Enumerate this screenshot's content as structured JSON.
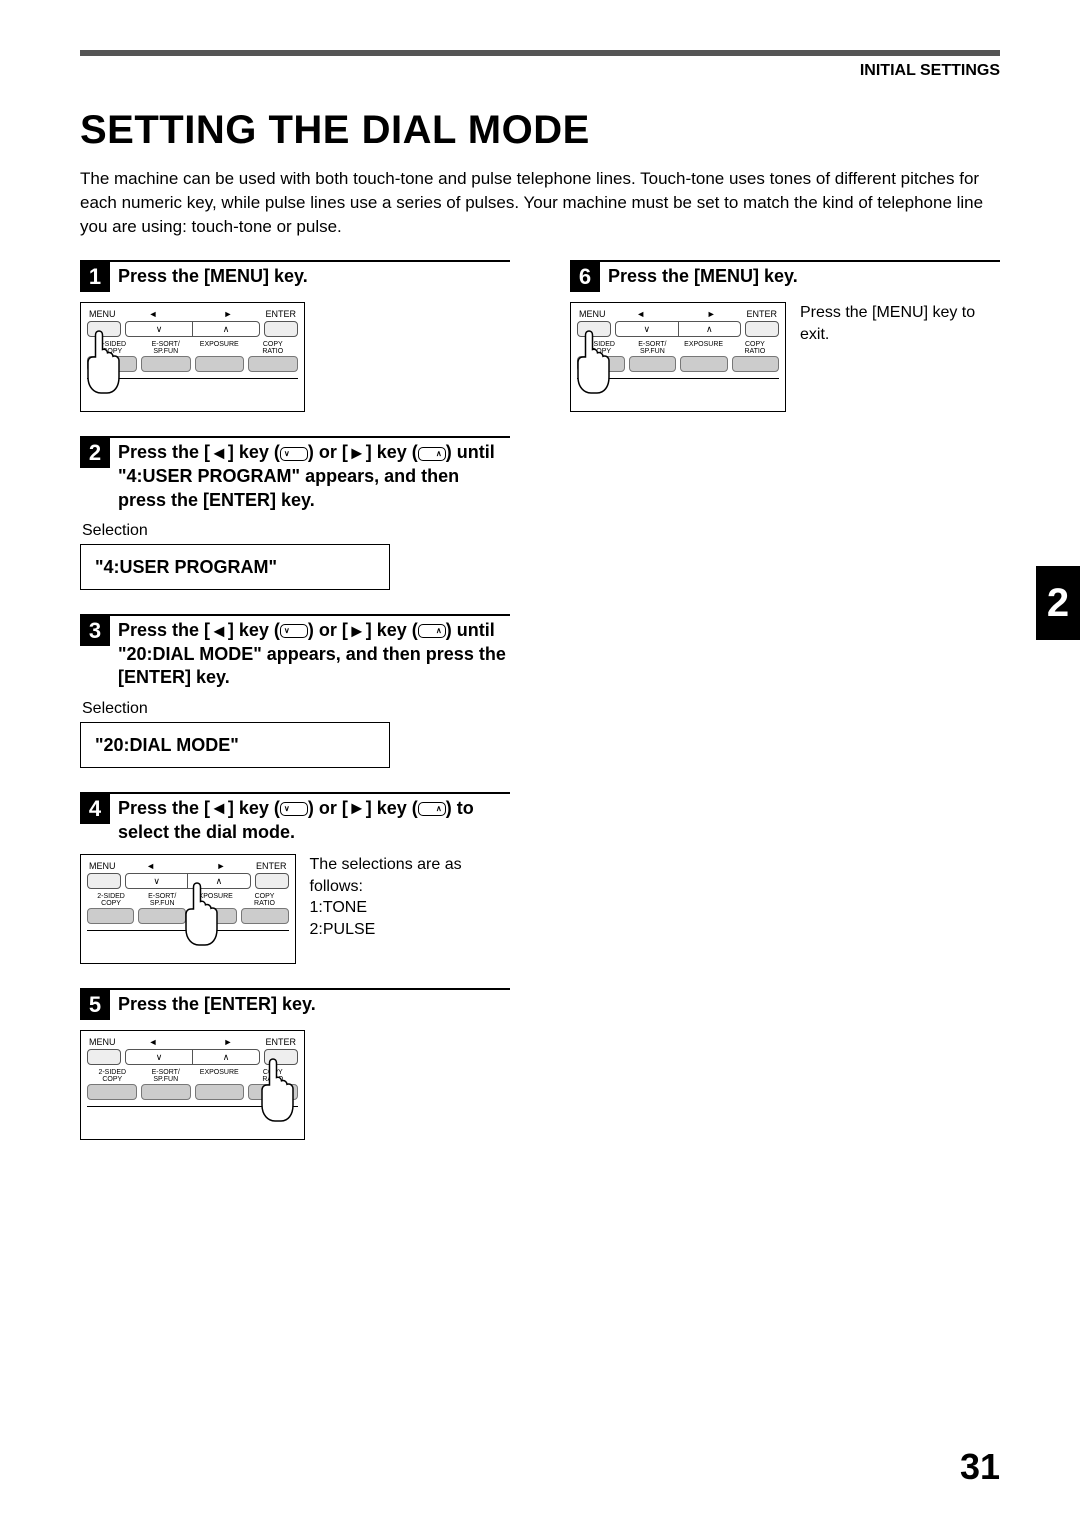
{
  "header": {
    "section": "INITIAL SETTINGS"
  },
  "title": "SETTING THE DIAL MODE",
  "intro": "The machine can be used with both touch-tone and pulse telephone lines. Touch-tone uses tones of different pitches for each numeric key, while pulse lines use a series of pulses. Your machine must be set to match the kind of telephone line you are using: touch-tone or pulse.",
  "panel": {
    "labels": {
      "menu": "MENU",
      "enter": "ENTER",
      "sided": "2-SIDED",
      "copy_under": "COPY",
      "esort": "E-SORT/",
      "spfun": "SP.FUN",
      "exposure": "EXPOSURE",
      "copyratio1": "COPY",
      "copyratio2": "RATIO",
      "left_tri": "◄",
      "right_tri": "►",
      "down": "∨",
      "up": "∧"
    }
  },
  "steps": {
    "s1": {
      "num": "1",
      "title": "Press the [MENU] key."
    },
    "s2": {
      "num": "2",
      "title_pre": "Press the [",
      "title_mid1": "] key (",
      "title_mid2": ") or [",
      "title_mid3": "] key (",
      "title_post": ") until \"4:USER PROGRAM\" appears, and then press the [ENTER] key.",
      "selection_label": "Selection",
      "display": "\"4:USER PROGRAM\""
    },
    "s3": {
      "num": "3",
      "title_pre": "Press the [",
      "title_mid1": "] key (",
      "title_mid2": ") or [",
      "title_mid3": "] key (",
      "title_post": ") until \"20:DIAL MODE\" appears, and then press the [ENTER] key.",
      "selection_label": "Selection",
      "display": "\"20:DIAL MODE\""
    },
    "s4": {
      "num": "4",
      "title_pre": "Press the [",
      "title_mid1": "] key (",
      "title_mid2": ") or [",
      "title_mid3": "] key (",
      "title_post": ") to select the dial mode.",
      "body": "The selections are as follows:\n1:TONE\n2:PULSE"
    },
    "s5": {
      "num": "5",
      "title": "Press the [ENTER] key."
    },
    "s6": {
      "num": "6",
      "title": "Press the [MENU] key.",
      "body": "Press the [MENU] key to exit."
    }
  },
  "side_tab": "2",
  "page_number": "31"
}
